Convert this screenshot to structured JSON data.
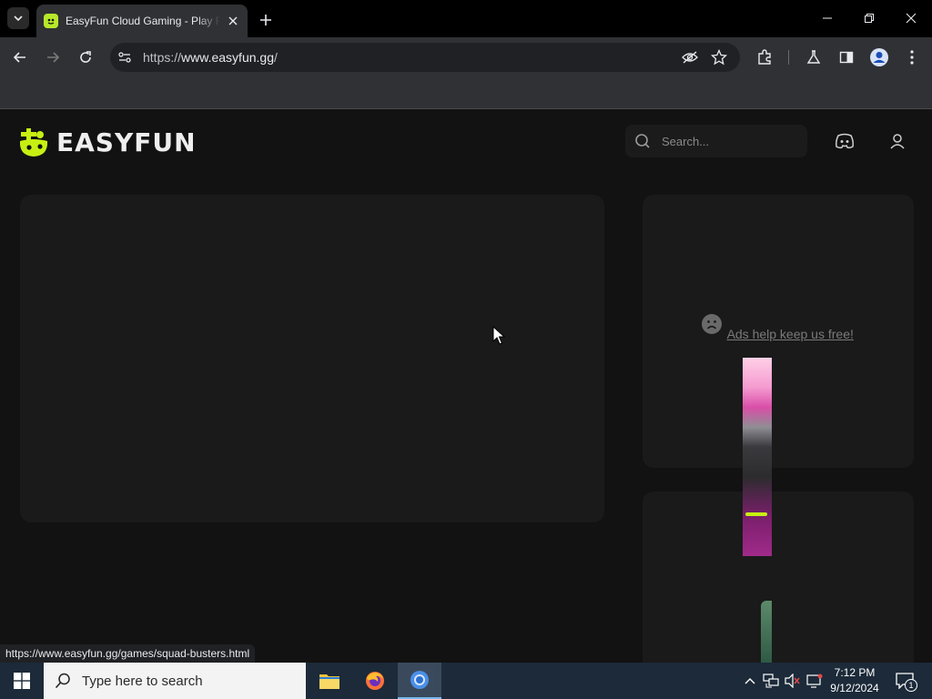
{
  "browser": {
    "tab": {
      "title": "EasyFun Cloud Gaming - Play Roblox Online"
    },
    "url": {
      "scheme": "https://",
      "host": "www.easyfun.gg",
      "path": "/"
    }
  },
  "site": {
    "logo_text": "EASYFUN",
    "search_placeholder": "Search...",
    "ad_message": "Ads help keep us free!"
  },
  "status_bar": {
    "url": "https://www.easyfun.gg/games/squad-busters.html"
  },
  "taskbar": {
    "search_placeholder": "Type here to search",
    "time": "7:12 PM",
    "date": "9/12/2024",
    "notification_count": "1"
  },
  "colors": {
    "accent": "#b7e82a",
    "page_bg": "#121212",
    "panel_bg": "#1a1a1a",
    "taskbar": "#1c2a39"
  },
  "icons": [
    "tab-search-icon",
    "favicon-icon",
    "tab-close-icon",
    "new-tab-icon",
    "minimize-icon",
    "restore-icon",
    "close-window-icon",
    "back-icon",
    "forward-icon",
    "reload-icon",
    "site-info-icon",
    "eye-off-icon",
    "star-icon",
    "extensions-icon",
    "labs-icon",
    "sidepanel-icon",
    "profile-icon",
    "menu-icon",
    "search-icon",
    "discord-icon",
    "user-icon",
    "sad-face-icon",
    "windows-start-icon",
    "file-explorer-icon",
    "firefox-icon",
    "chrome-icon"
  ]
}
